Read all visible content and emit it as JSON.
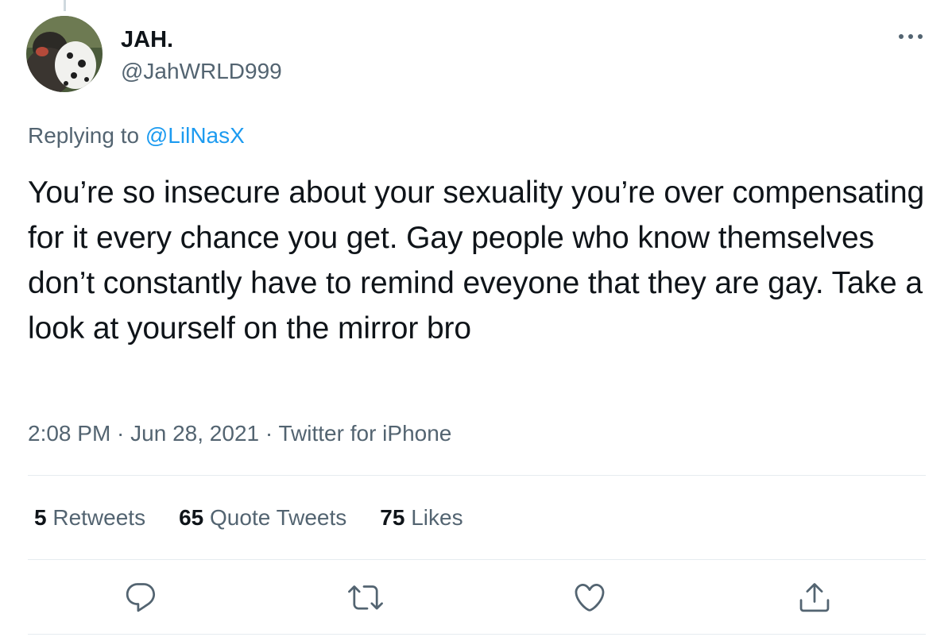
{
  "user": {
    "display_name": "JAH.",
    "handle": "@JahWRLD999",
    "avatar_icon": "profile-photo"
  },
  "reply": {
    "prefix": "Replying to ",
    "mention": "@LilNasX"
  },
  "tweet": {
    "text": "You’re so insecure about your sexuality you’re over compensating for it every chance you get. Gay people who know themselves don’t constantly have to remind eveyone that they are gay. Take a look at yourself on the mirror bro"
  },
  "meta": {
    "time": "2:08 PM",
    "sep1": " · ",
    "date": "Jun 28, 2021",
    "sep2": " · ",
    "source": "Twitter for iPhone"
  },
  "stats": {
    "retweets_count": "5",
    "retweets_label": " Retweets",
    "quotes_count": "65",
    "quotes_label": " Quote Tweets",
    "likes_count": "75",
    "likes_label": " Likes"
  },
  "actions": {
    "reply_icon": "reply-icon",
    "retweet_icon": "retweet-icon",
    "like_icon": "heart-icon",
    "share_icon": "share-icon",
    "more_icon": "more-dots-icon"
  },
  "colors": {
    "link": "#1d9bf0",
    "secondary_text": "#536471",
    "primary_text": "#0f1419",
    "divider": "#e6ecf0"
  }
}
